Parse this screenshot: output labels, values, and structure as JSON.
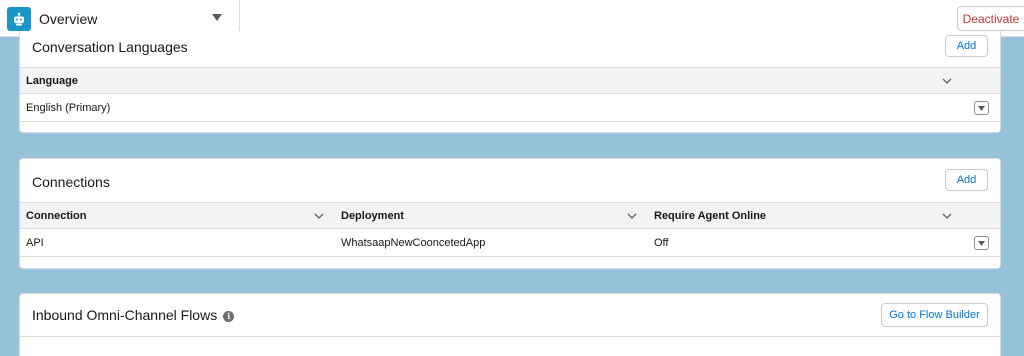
{
  "topbar": {
    "nav_label": "Overview",
    "icon": "einstein-bot-icon",
    "deactivate_label": "Deactivate"
  },
  "languages": {
    "title": "Conversation Languages",
    "add_label": "Add",
    "columns": [
      "Language"
    ],
    "rows": [
      [
        "English (Primary)"
      ]
    ]
  },
  "connections": {
    "title": "Connections",
    "add_label": "Add",
    "columns": [
      "Connection",
      "Deployment",
      "Require Agent Online"
    ],
    "rows": [
      [
        "API",
        "WhatsaapNewCooncetedApp",
        "Off"
      ]
    ]
  },
  "flows": {
    "title": "Inbound Omni-Channel Flows",
    "info_icon": "info-icon",
    "button_label": "Go to Flow Builder"
  },
  "colors": {
    "background": "#96c2da",
    "accent": "#0176d3",
    "destructive": "#c23934",
    "bot_icon": "#1b96c8"
  }
}
